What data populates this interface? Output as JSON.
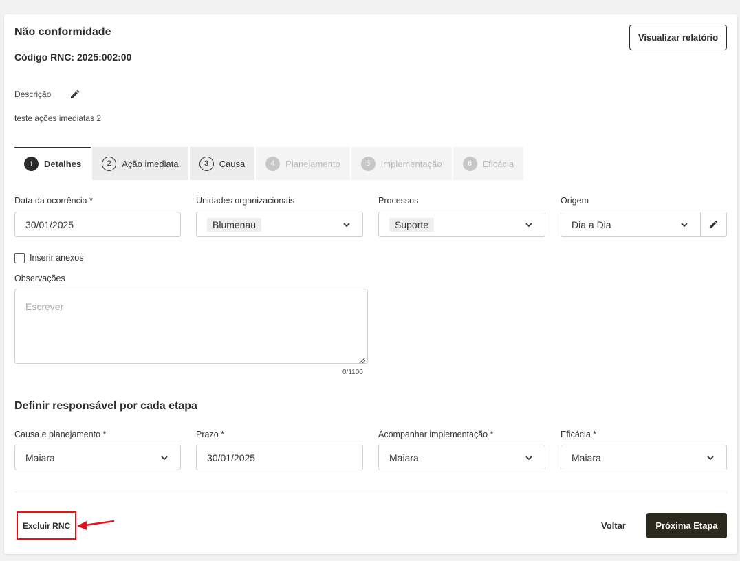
{
  "header": {
    "title": "Não conformidade",
    "code": "Código RNC: 2025:002:00",
    "report_button": "Visualizar relatório"
  },
  "description": {
    "label": "Descrição",
    "text": "teste ações imediatas 2",
    "edit_icon": "pencil-icon"
  },
  "tabs": [
    {
      "num": "1",
      "label": "Detalhes",
      "state": "active"
    },
    {
      "num": "2",
      "label": "Ação imediata",
      "state": "normal"
    },
    {
      "num": "3",
      "label": "Causa",
      "state": "normal"
    },
    {
      "num": "4",
      "label": "Planejamento",
      "state": "disabled"
    },
    {
      "num": "5",
      "label": "Implementação",
      "state": "disabled"
    },
    {
      "num": "6",
      "label": "Eficácia",
      "state": "disabled"
    }
  ],
  "details": {
    "date": {
      "label": "Data da ocorrência *",
      "value": "30/01/2025"
    },
    "units": {
      "label": "Unidades organizacionais",
      "value": "Blumenau"
    },
    "processes": {
      "label": "Processos",
      "value": "Suporte"
    },
    "origin": {
      "label": "Origem",
      "value": "Dia a Dia"
    },
    "attachments": {
      "label": "Inserir anexos",
      "checked": false
    },
    "observations": {
      "label": "Observações",
      "placeholder": "Escrever",
      "counter": "0/1100"
    }
  },
  "responsibles": {
    "title": "Definir responsável por cada etapa",
    "cause": {
      "label": "Causa e planejamento *",
      "value": "Maiara"
    },
    "deadline": {
      "label": "Prazo *",
      "value": "30/01/2025"
    },
    "implementation": {
      "label": "Acompanhar implementação *",
      "value": "Maiara"
    },
    "efficacy": {
      "label": "Eficácia *",
      "value": "Maiara"
    }
  },
  "footer": {
    "delete_button": "Excluir RNC",
    "back_button": "Voltar",
    "next_button": "Próxima Etapa"
  },
  "colors": {
    "primary": "#2b2a1f",
    "highlight": "#e8101a"
  }
}
